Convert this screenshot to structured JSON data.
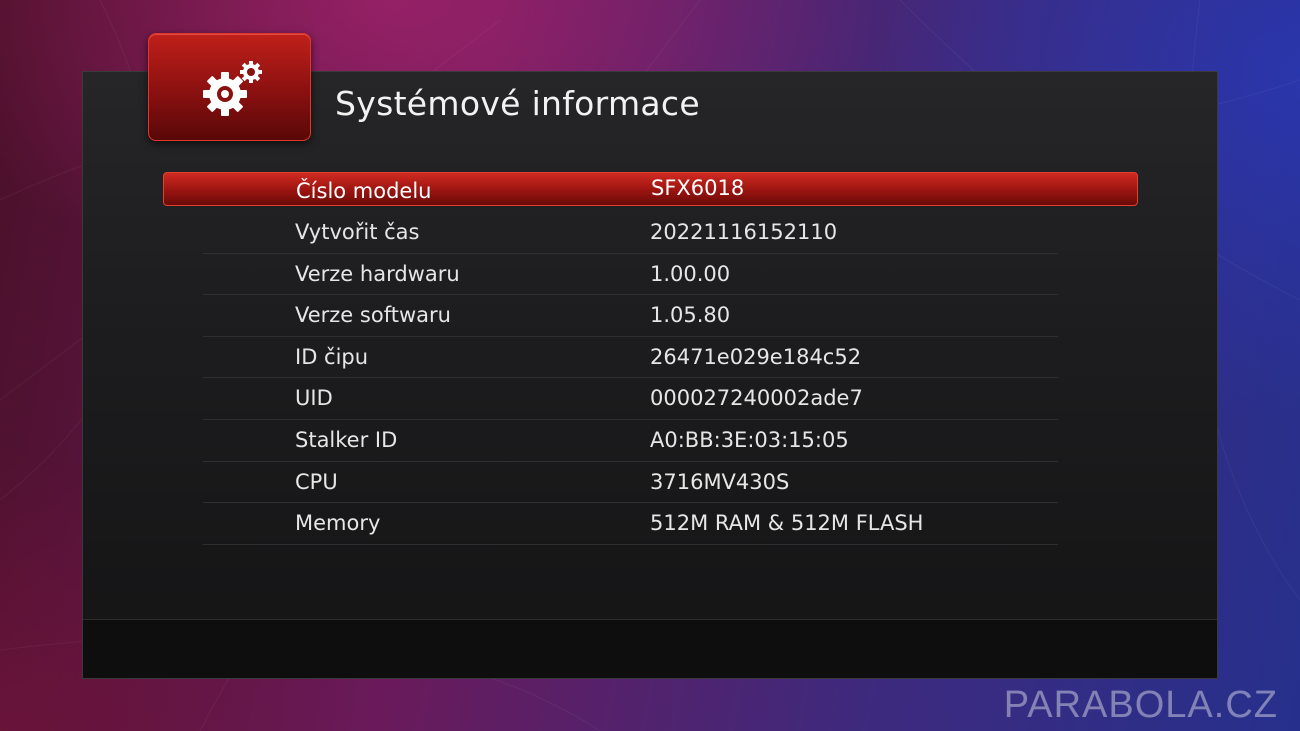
{
  "header": {
    "title": "Systémové informace",
    "icon": "gears-icon"
  },
  "info_rows": [
    {
      "label": "Číslo modelu",
      "value": "SFX6018",
      "selected": true
    },
    {
      "label": "Vytvořit čas",
      "value": "20221116152110"
    },
    {
      "label": "Verze hardwaru",
      "value": "1.00.00"
    },
    {
      "label": "Verze softwaru",
      "value": "1.05.80"
    },
    {
      "label": "ID čipu",
      "value": "26471e029e184c52"
    },
    {
      "label": "UID",
      "value": "000027240002ade7"
    },
    {
      "label": "Stalker ID",
      "value": "A0:BB:3E:03:15:05"
    },
    {
      "label": "CPU",
      "value": "3716MV430S"
    },
    {
      "label": "Memory",
      "value": "512M RAM & 512M FLASH"
    }
  ],
  "watermark": "PARABOLA.CZ",
  "colors": {
    "accent": "#c0201a",
    "panel": "#1d1d1f",
    "text": "#e6e6e6"
  }
}
